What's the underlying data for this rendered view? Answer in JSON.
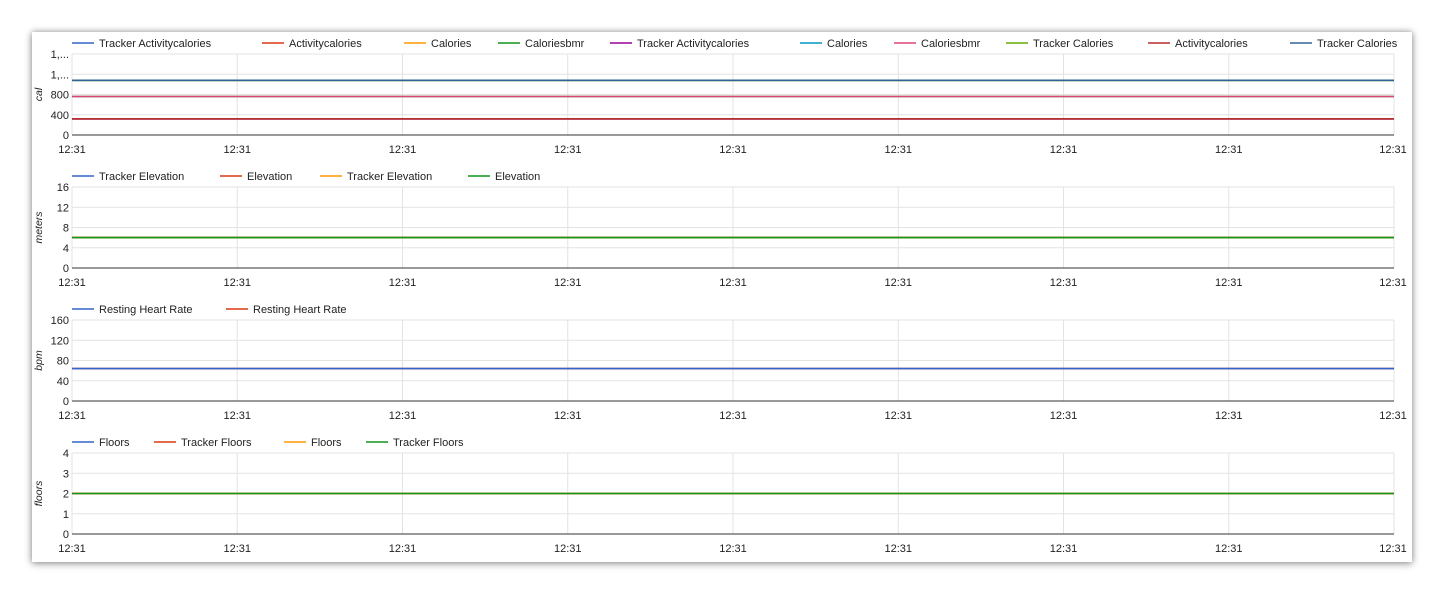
{
  "chart_data": [
    {
      "type": "line",
      "ylabel": "cal",
      "y_ticks": [
        "0",
        "400",
        "800",
        "1,...",
        "1,..."
      ],
      "ylim": [
        0,
        2000
      ],
      "x_ticks": [
        "12:31",
        "12:31",
        "12:31",
        "12:31",
        "12:31",
        "12:31",
        "12:31",
        "12:31",
        "12:31"
      ],
      "grid": true,
      "legend_position": "top",
      "series": [
        {
          "name": "Tracker Activitycalories",
          "color": "#3366cc",
          "values": [
            400,
            400
          ]
        },
        {
          "name": "Activitycalories",
          "color": "#dc3912",
          "values": [
            400,
            400
          ]
        },
        {
          "name": "Calories",
          "color": "#ff9900",
          "values": [
            1350,
            1350
          ]
        },
        {
          "name": "Caloriesbmr",
          "color": "#109618",
          "values": [
            950,
            950
          ]
        },
        {
          "name": "Tracker Activitycalories",
          "color": "#990099",
          "values": [
            400,
            400
          ]
        },
        {
          "name": "Calories",
          "color": "#0099c6",
          "values": [
            1350,
            1350
          ]
        },
        {
          "name": "Caloriesbmr",
          "color": "#dd4477",
          "values": [
            950,
            950
          ]
        },
        {
          "name": "Tracker Calories",
          "color": "#66aa00",
          "values": [
            1350,
            1350
          ]
        },
        {
          "name": "Activitycalories",
          "color": "#b82e2e",
          "values": [
            400,
            400
          ]
        },
        {
          "name": "Tracker Calories",
          "color": "#316395",
          "values": [
            1350,
            1350
          ]
        }
      ]
    },
    {
      "type": "line",
      "ylabel": "meters",
      "y_ticks": [
        "0",
        "4",
        "8",
        "12",
        "16"
      ],
      "ylim": [
        0,
        16
      ],
      "x_ticks": [
        "12:31",
        "12:31",
        "12:31",
        "12:31",
        "12:31",
        "12:31",
        "12:31",
        "12:31",
        "12:31"
      ],
      "grid": true,
      "legend_position": "top",
      "series": [
        {
          "name": "Tracker Elevation",
          "color": "#3366cc",
          "values": [
            6,
            6
          ]
        },
        {
          "name": "Elevation",
          "color": "#dc3912",
          "values": [
            6,
            6
          ]
        },
        {
          "name": "Tracker Elevation",
          "color": "#ff9900",
          "values": [
            6,
            6
          ]
        },
        {
          "name": "Elevation",
          "color": "#109618",
          "values": [
            6,
            6
          ]
        }
      ]
    },
    {
      "type": "line",
      "ylabel": "bpm",
      "y_ticks": [
        "0",
        "40",
        "80",
        "120",
        "160"
      ],
      "ylim": [
        0,
        160
      ],
      "x_ticks": [
        "12:31",
        "12:31",
        "12:31",
        "12:31",
        "12:31",
        "12:31",
        "12:31",
        "12:31",
        "12:31"
      ],
      "grid": true,
      "legend_position": "top",
      "series": [
        {
          "name": "Resting Heart Rate",
          "color": "#dc3912",
          "values": [
            64,
            64
          ]
        },
        {
          "name": "Resting Heart Rate",
          "color": "#3366cc",
          "values": [
            64,
            64
          ]
        }
      ],
      "legend_order": [
        1,
        0
      ]
    },
    {
      "type": "line",
      "ylabel": "floors",
      "y_ticks": [
        "0",
        "1",
        "2",
        "3",
        "4"
      ],
      "ylim": [
        0,
        4
      ],
      "x_ticks": [
        "12:31",
        "12:31",
        "12:31",
        "12:31",
        "12:31",
        "12:31",
        "12:31",
        "12:31",
        "12:31"
      ],
      "grid": true,
      "legend_position": "top",
      "series": [
        {
          "name": "Floors",
          "color": "#3366cc",
          "values": [
            2,
            2
          ]
        },
        {
          "name": "Tracker Floors",
          "color": "#dc3912",
          "values": [
            2,
            2
          ]
        },
        {
          "name": "Floors",
          "color": "#ff9900",
          "values": [
            2,
            2
          ]
        },
        {
          "name": "Tracker Floors",
          "color": "#109618",
          "values": [
            2,
            2
          ]
        }
      ]
    }
  ]
}
